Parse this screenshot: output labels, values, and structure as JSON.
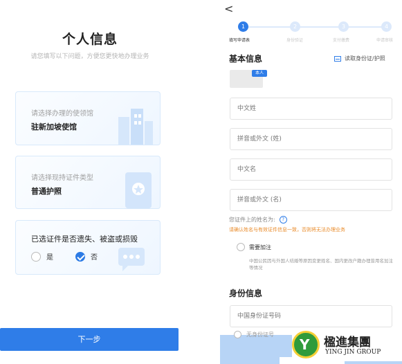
{
  "left": {
    "title": "个人信息",
    "subtitle": "请您填写以下问题，方便您更快地办理业务",
    "embassy_hint": "请选择办理的使领馆",
    "embassy_value": "驻新加坡使馆",
    "doc_type_hint": "请选择现持证件类型",
    "doc_type_value": "普通护照",
    "lost_question": "已选证件是否遗失、被盗或损毁",
    "option_yes": "是",
    "option_no": "否",
    "selected_option": "否",
    "next_button": "下一步"
  },
  "right": {
    "back_glyph": "<",
    "steps": [
      {
        "num": "1",
        "label": "填写申请表",
        "active": true
      },
      {
        "num": "2",
        "label": "身份验证",
        "active": false
      },
      {
        "num": "3",
        "label": "支付缴费",
        "active": false
      },
      {
        "num": "4",
        "label": "申请审核",
        "active": false
      }
    ],
    "section_basic": "基本信息",
    "read_id_link": "读取身份证/护照",
    "self_badge": "本人",
    "fields": {
      "cn_surname": "中文姓",
      "foreign_surname": "拼音或外文 (姓)",
      "cn_given": "中文名",
      "foreign_given": "拼音或外文 (名)"
    },
    "name_on_doc": "您证件上的姓名为:",
    "help_glyph": "?",
    "warning": "请确认姓名与有效证件信息一致，否则将无法办理业务",
    "add_name_option": "需要加注",
    "add_name_note": "中国公民因与外国人结婚等原因变更姓名、国内更改户籍办理曾用名加注等情况",
    "section_identity": "身份信息",
    "id_number_field": "中国身份证号码",
    "id_option_partial": "无身份证号"
  },
  "watermark": {
    "cn": "楹進集團",
    "en": "YING JIN GROUP",
    "mark": "Y"
  },
  "colors": {
    "primary": "#2f7de8",
    "warning": "#e98b2a",
    "logo_green": "#2f9b3b",
    "logo_gold": "#f4cf36"
  }
}
